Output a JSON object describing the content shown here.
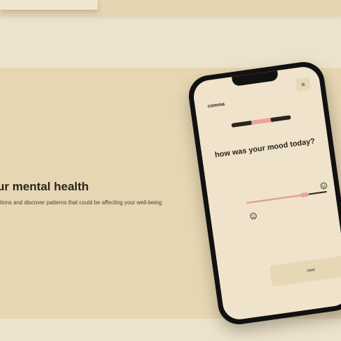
{
  "hero": {
    "title": "ur mental health",
    "subtitle": "tions and discover patterns that could be affecting your well-being"
  },
  "app": {
    "brand": "comma",
    "menu_icon": "hamburger-icon",
    "steps_total": 3,
    "step_current": 2,
    "question": "how was your mood today?",
    "mood_value": 0.72,
    "low_icon": "sad-face-icon",
    "high_icon": "happy-face-icon",
    "next_label": "next"
  },
  "colors": {
    "background": "#ede3cc",
    "hero": "#e6d6b2",
    "accent": "#f0a09a",
    "ink": "#2a241c",
    "phone_frame": "#111111",
    "button": "#e6d7b5"
  }
}
